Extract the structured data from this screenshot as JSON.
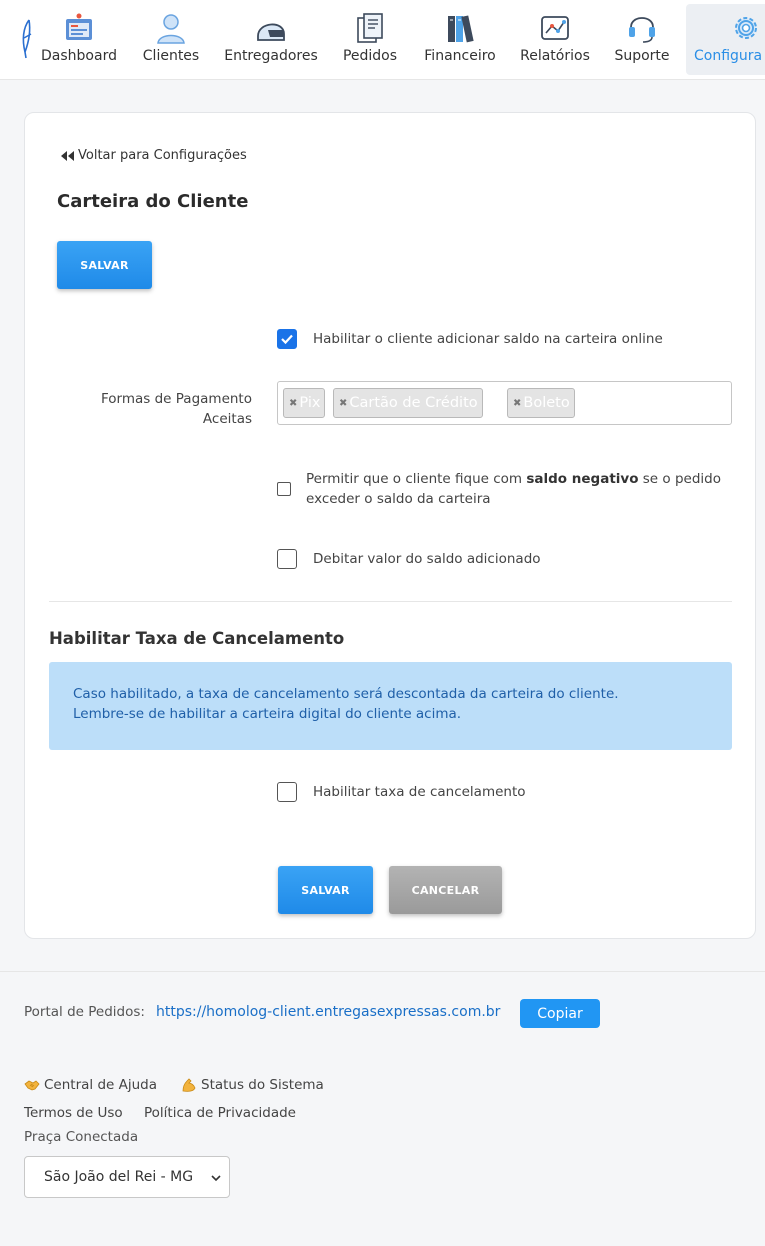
{
  "nav": {
    "items": [
      {
        "label": "Dashboard",
        "icon": "dashboard-icon"
      },
      {
        "label": "Clientes",
        "icon": "user-icon"
      },
      {
        "label": "Entregadores",
        "icon": "helmet-icon"
      },
      {
        "label": "Pedidos",
        "icon": "receipt-icon"
      },
      {
        "label": "Financeiro",
        "icon": "books-icon"
      },
      {
        "label": "Relatórios",
        "icon": "chart-icon"
      },
      {
        "label": "Suporte",
        "icon": "headset-icon"
      },
      {
        "label": "Configura",
        "icon": "gear-icon",
        "active": true
      }
    ]
  },
  "page": {
    "back_label": "Voltar para Configurações",
    "title": "Carteira do Cliente",
    "save_label": "SALVAR",
    "enable_wallet_label": "Habilitar o cliente adicionar saldo na carteira online",
    "enable_wallet_checked": true,
    "payment_label": "Formas de Pagamento Aceitas",
    "payment_methods": [
      "Pix",
      "Cartão de Crédito",
      "Boleto"
    ],
    "negative_balance_pre": "Permitir que o cliente fique com ",
    "negative_balance_bold": "saldo negativo",
    "negative_balance_post": " se o pedido exceder o saldo da carteira",
    "debit_label": "Debitar valor do saldo adicionado",
    "cancel_fee_title": "Habilitar Taxa de Cancelamento",
    "alert_line1": "Caso habilitado, a taxa de cancelamento será descontada da carteira do cliente.",
    "alert_line2": "Lembre-se de habilitar a carteira digital do cliente acima.",
    "cancel_fee_label": "Habilitar taxa de cancelamento",
    "save_bottom_label": "SALVAR",
    "cancel_label": "CANCELAR"
  },
  "footer": {
    "portal_label": "Portal de Pedidos:",
    "portal_url": "https://homolog-client.entregasexpressas.com.br",
    "copy_label": "Copiar",
    "help_label": "Central de Ajuda",
    "status_label": "Status do Sistema",
    "terms_label": "Termos de Uso",
    "privacy_label": "Política de Privacidade",
    "praca_label": "Praça Conectada",
    "praca_value": "São João del Rei - MG"
  },
  "colors": {
    "accent": "#2196f3",
    "alert_bg": "#bcdef9",
    "alert_text": "#1f5fa8"
  }
}
